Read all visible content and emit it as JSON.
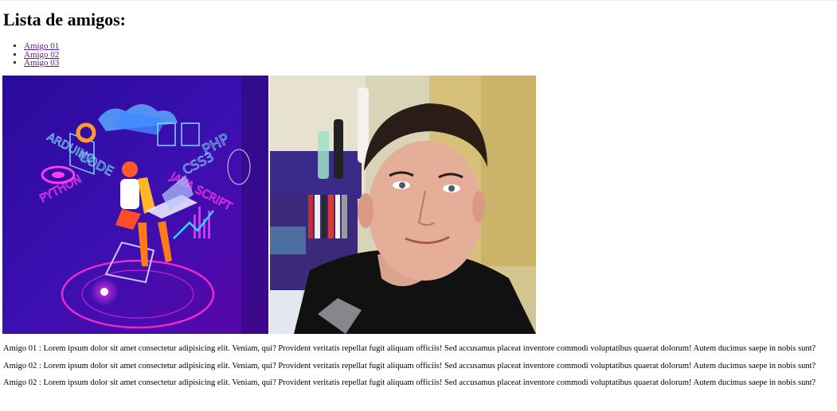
{
  "heading": "Lista de amigos:",
  "friends": [
    {
      "label": "Amigo 01"
    },
    {
      "label": "Amigo 02"
    },
    {
      "label": "Amigo 03"
    }
  ],
  "photos": [
    {
      "kind": "illustration",
      "texts": [
        "ARDUINO",
        "CODE",
        "PYTHON",
        "PHP",
        "CSS3",
        "JAVA SCRIPT"
      ]
    },
    {
      "kind": "portrait"
    }
  ],
  "paragraphs": [
    "Amigo 01 : Lorem ipsum dolor sit amet consectetur adipisicing elit. Veniam, qui? Provident veritatis repellat fugit aliquam officiis! Sed accusamus placeat inventore commodi voluptatibus quaerat dolorum! Autem ducimus saepe in nobis sunt?",
    "Amigo 02 : Lorem ipsum dolor sit amet consectetur adipisicing elit. Veniam, qui? Provident veritatis repellat fugit aliquam officiis! Sed accusamus placeat inventore commodi voluptatibus quaerat dolorum! Autem ducimus saepe in nobis sunt?",
    "Amigo 02 : Lorem ipsum dolor sit amet consectetur adipisicing elit. Veniam, qui? Provident veritatis repellat fugit aliquam officiis! Sed accusamus placeat inventore commodi voluptatibus quaerat dolorum! Autem ducimus saepe in nobis sunt?"
  ],
  "colors": {
    "link": "#551a8b",
    "illustration_bg": "#3a0ca3",
    "illustration_glow": "#ff2bd6"
  }
}
